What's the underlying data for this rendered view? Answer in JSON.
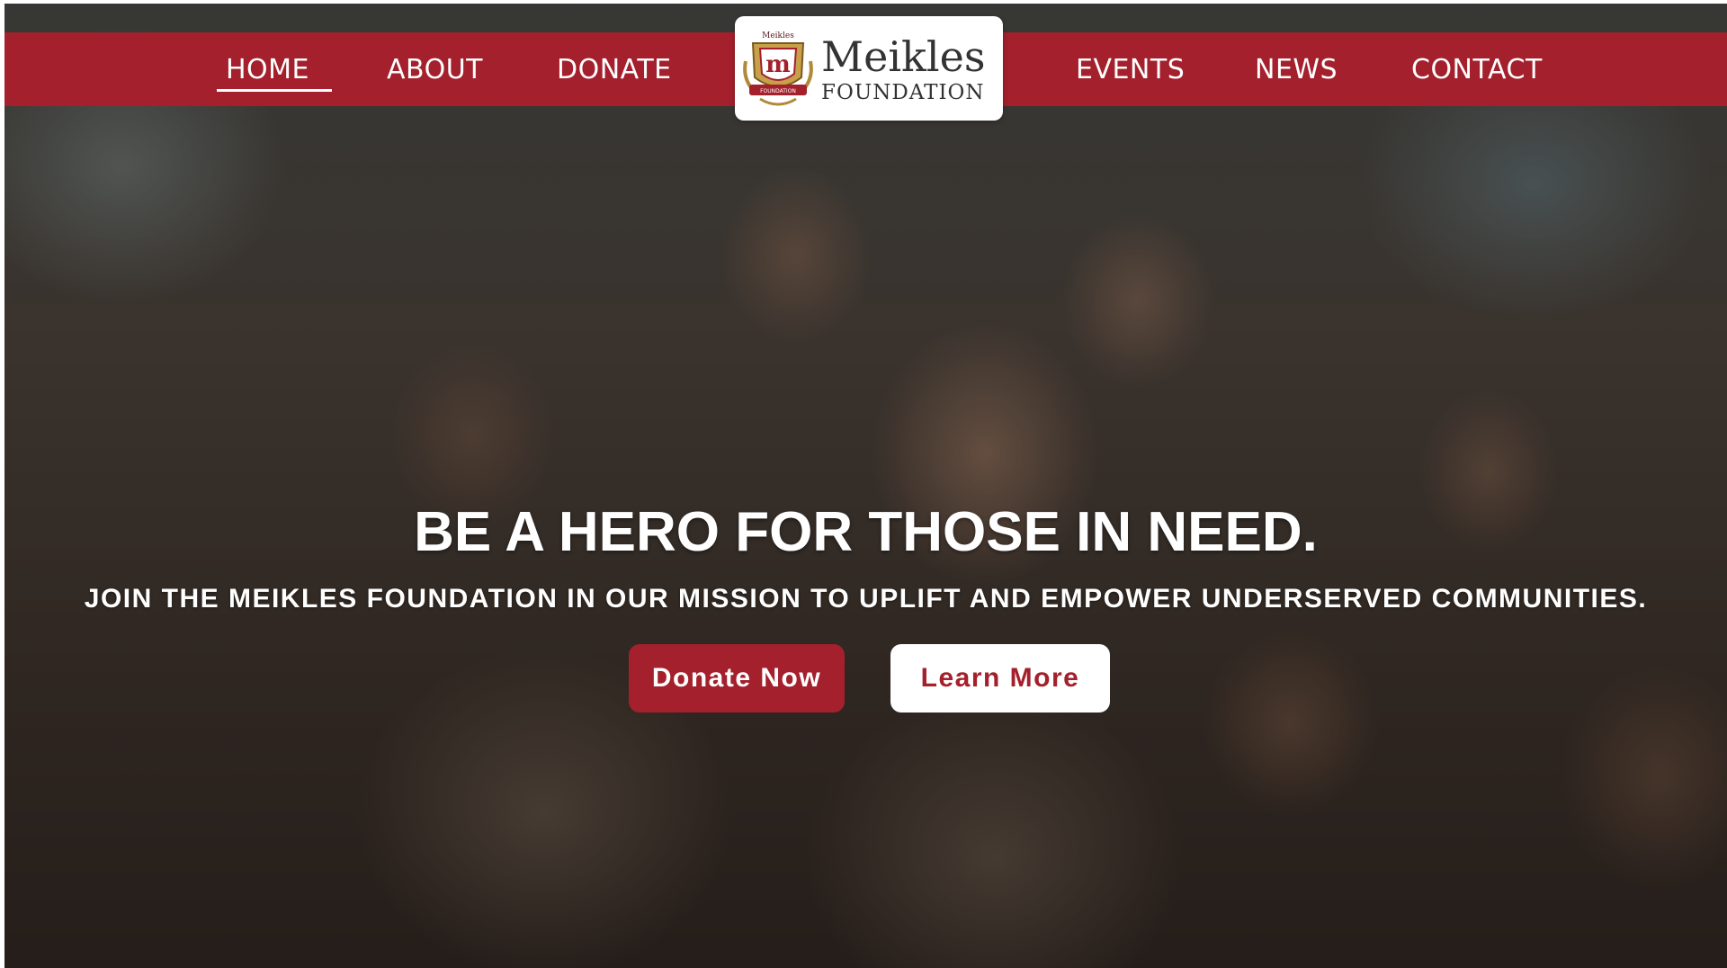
{
  "colors": {
    "brand_red": "#a3202c",
    "white": "#ffffff"
  },
  "nav": {
    "left_items": [
      {
        "label": "HOME",
        "active": true
      },
      {
        "label": "ABOUT",
        "active": false
      },
      {
        "label": "DONATE",
        "active": false
      }
    ],
    "right_items": [
      {
        "label": "EVENTS",
        "active": false
      },
      {
        "label": "NEWS",
        "active": false
      },
      {
        "label": "CONTACT",
        "active": false
      }
    ]
  },
  "logo": {
    "title": "Meikles",
    "subtitle": "FOUNDATION",
    "crest_top_text": "Meikles",
    "crest_ribbon_text": "FOUNDATION",
    "crest_icon": "crest-icon"
  },
  "hero": {
    "heading": "BE A HERO FOR THOSE IN NEED.",
    "subheading": "JOIN THE MEIKLES FOUNDATION IN OUR MISSION TO UPLIFT AND EMPOWER UNDERSERVED COMMUNITIES.",
    "primary_button": "Donate Now",
    "secondary_button": "Learn More",
    "background_image": "hero-photo"
  }
}
